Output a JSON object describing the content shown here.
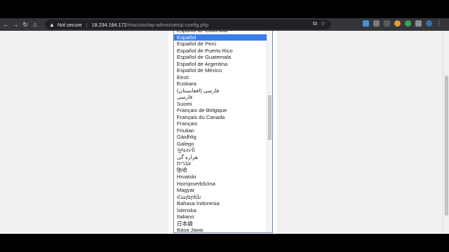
{
  "browser": {
    "security_label": "Not secure",
    "url_host": "18.234.184.172",
    "url_path": "/macizos/wp-admin/setup-config.php"
  },
  "language_list": {
    "selected_index": 1,
    "items": [
      "Español de Colombia",
      "Español",
      "Español de Perú",
      "Español de Puerto Rico",
      "Español de Guatemala",
      "Español de Argentina",
      "Español de México",
      "Eesti",
      "Euskara",
      "فارسی (افغانستان)",
      "فارسی",
      "Suomi",
      "Français de Belgique",
      "Français du Canada",
      "Français",
      "Friulian",
      "Gàidhlig",
      "Galego",
      "ગુજરાતી",
      "هزاره گی",
      "עברית",
      "हिन्दी",
      "Hrvatski",
      "Hornjoserbšćina",
      "Magyar",
      "Հայերեն",
      "Bahasa Indonesia",
      "Íslenska",
      "Italiano",
      "日本語",
      "Basa Jawa"
    ]
  },
  "colors": {
    "selection": "#3b7de9",
    "toolbar": "#35363a",
    "page_bg": "#f1f1f1"
  }
}
